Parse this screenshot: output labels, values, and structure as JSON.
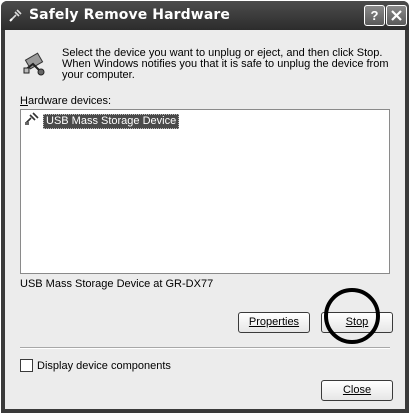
{
  "window": {
    "title": "Safely Remove Hardware",
    "help_button": "?",
    "close_button": "X"
  },
  "instructions": "Select the device you want to unplug or eject, and then click Stop. When Windows notifies you that it is safe to unplug the device from your computer.",
  "hardware_devices": {
    "label": "Hardware devices:",
    "items": [
      {
        "label": "USB Mass Storage Device",
        "icon": "usb-device-icon",
        "selected": true
      }
    ]
  },
  "selected_device_description": "USB Mass Storage Device at GR-DX77",
  "buttons": {
    "properties": "Properties",
    "stop": "Stop",
    "close": "Close"
  },
  "display_components": {
    "label": "Display device components",
    "checked": false
  },
  "annotation": "circle highlighting Stop button"
}
